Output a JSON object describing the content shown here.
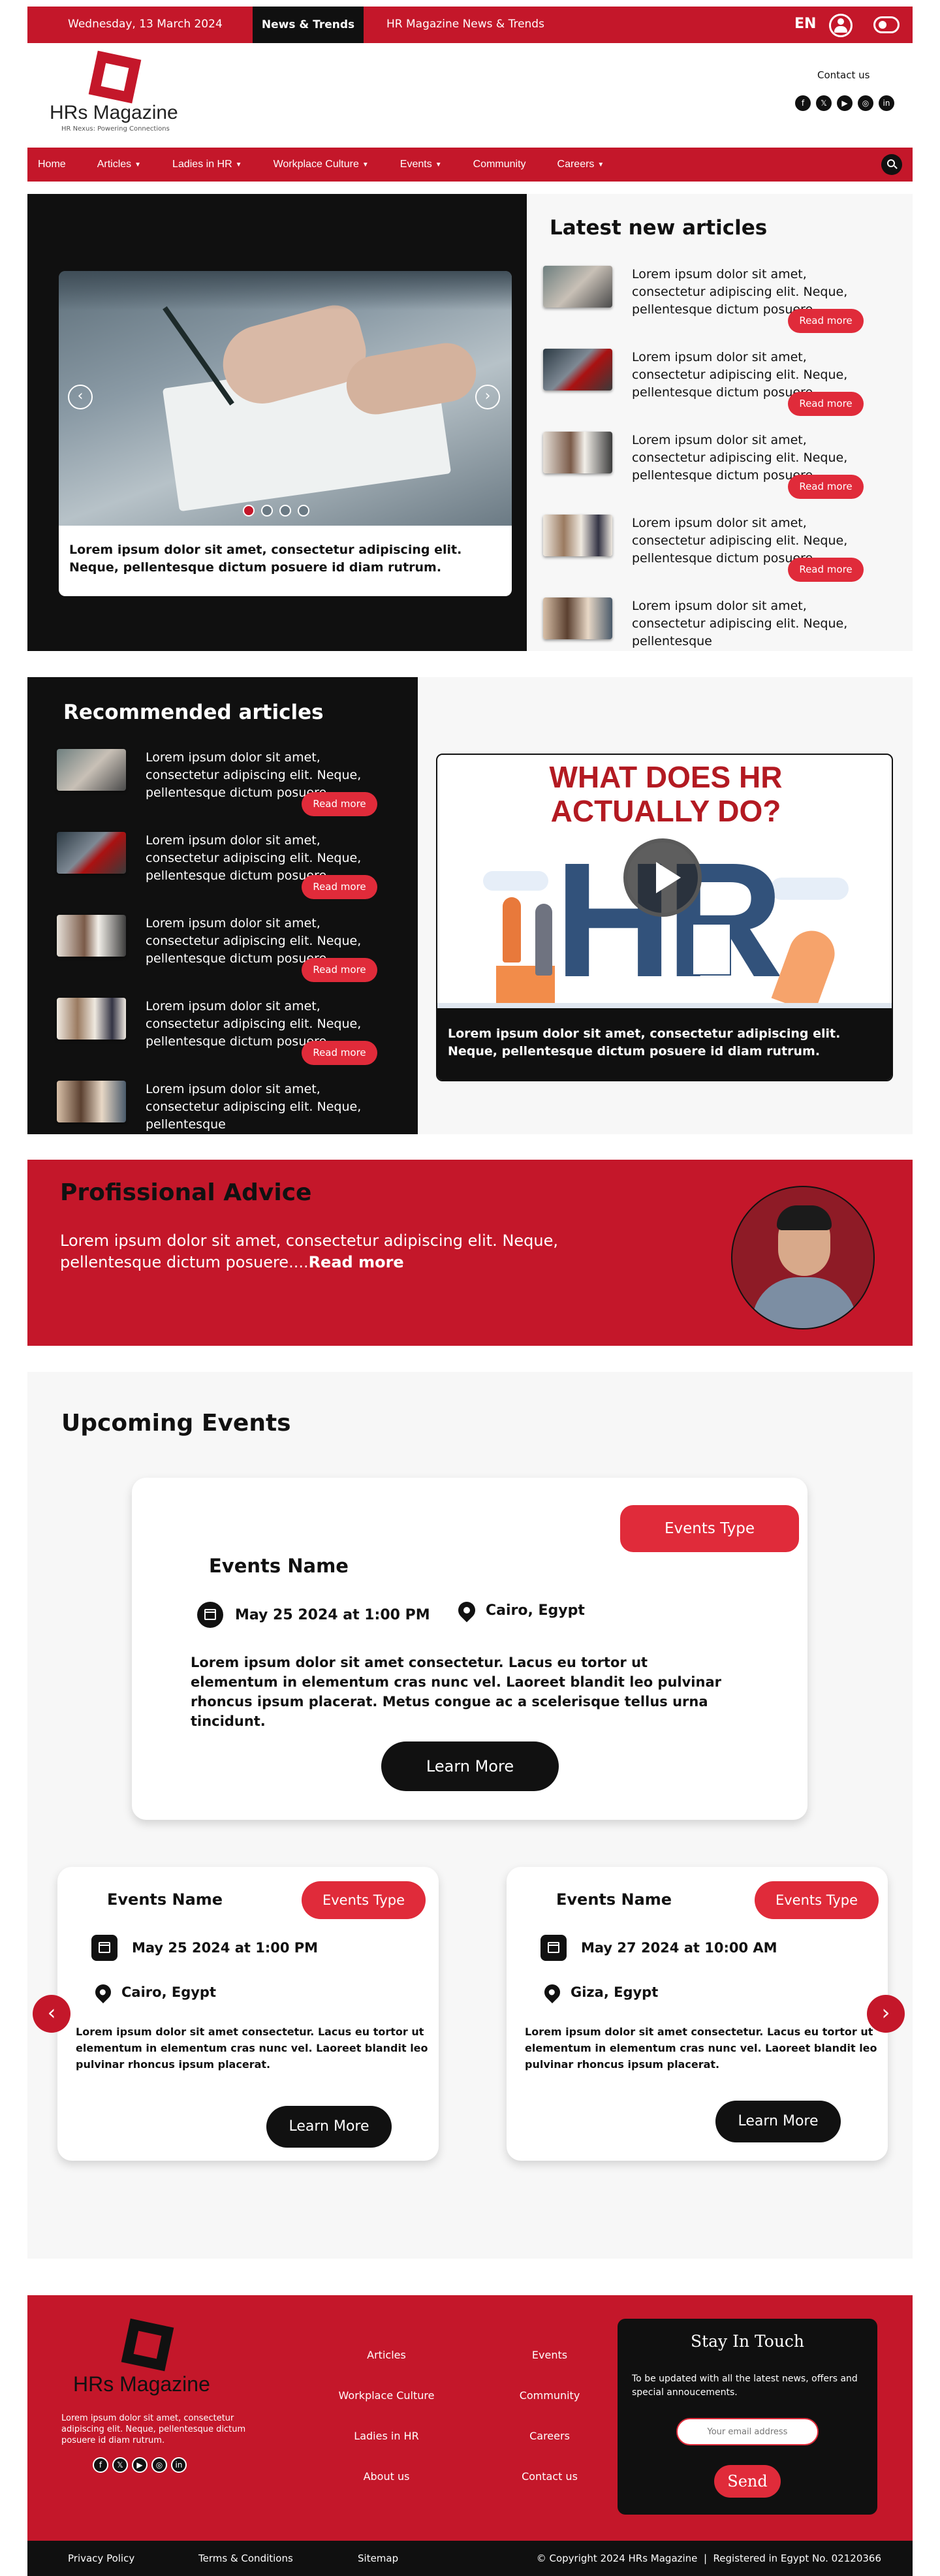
{
  "topbar": {
    "date": "Wednesday, 13 March 2024",
    "tab_active": "News & Trends",
    "tab_other": "HR Magazine News & Trends",
    "lang": "EN"
  },
  "brand": {
    "name": "HRs Magazine",
    "tagline": "HR Nexus: Powering Connections"
  },
  "header": {
    "contact": "Contact us"
  },
  "nav": {
    "items": [
      {
        "label": "Home",
        "caret": false
      },
      {
        "label": "Articles",
        "caret": true
      },
      {
        "label": "Ladies in HR",
        "caret": true
      },
      {
        "label": "Workplace Culture",
        "caret": true
      },
      {
        "label": "Events",
        "caret": true
      },
      {
        "label": "Community",
        "caret": false
      },
      {
        "label": "Careers",
        "caret": true
      }
    ]
  },
  "hero": {
    "caption": "Lorem ipsum dolor sit amet, consectetur adipiscing elit. Neque, pellentesque dictum posuere id diam rutrum.",
    "dots": 4
  },
  "latest": {
    "title": "Latest new articles",
    "items": [
      {
        "text": "Lorem ipsum dolor sit amet, consectetur adipiscing elit. Neque, pellentesque dictum posuere.....",
        "button": "Read more"
      },
      {
        "text": "Lorem ipsum dolor sit amet, consectetur adipiscing elit. Neque, pellentesque dictum posuere.....",
        "button": "Read more"
      },
      {
        "text": "Lorem ipsum dolor sit amet, consectetur adipiscing elit. Neque, pellentesque dictum posuere.....",
        "button": "Read more"
      },
      {
        "text": "Lorem ipsum dolor sit amet, consectetur adipiscing elit. Neque, pellentesque dictum posuere.....",
        "button": "Read more"
      },
      {
        "text": "Lorem ipsum dolor sit amet, consectetur adipiscing elit. Neque, pellentesque",
        "button": ""
      }
    ]
  },
  "recommended": {
    "title": "Recommended articles",
    "items": [
      {
        "text": "Lorem ipsum dolor sit amet, consectetur adipiscing elit. Neque, pellentesque dictum posuere.....",
        "button": "Read more"
      },
      {
        "text": "Lorem ipsum dolor sit amet, consectetur adipiscing elit. Neque, pellentesque dictum posuere.....",
        "button": "Read more"
      },
      {
        "text": "Lorem ipsum dolor sit amet, consectetur adipiscing elit. Neque, pellentesque dictum posuere.....",
        "button": "Read more"
      },
      {
        "text": "Lorem ipsum dolor sit amet, consectetur adipiscing elit. Neque, pellentesque dictum posuere.....",
        "button": "Read more"
      },
      {
        "text": "Lorem ipsum dolor sit amet, consectetur adipiscing elit. Neque, pellentesque",
        "button": ""
      }
    ]
  },
  "video": {
    "heading_line1": "WHAT DOES HR",
    "heading_line2": "ACTUALLY DO?",
    "art_letters": "HR",
    "caption": "Lorem ipsum dolor sit amet, consectetur adipiscing elit. Neque, pellentesque dictum posuere id diam rutrum."
  },
  "advice": {
    "title": "Profissional Advice",
    "text": "Lorem ipsum dolor sit amet, consectetur adipiscing elit. Neque, pellentesque dictum posuere....",
    "more": "Read more"
  },
  "events": {
    "title": "Upcoming Events",
    "featured": {
      "type": "Events Type",
      "name": "Events Name",
      "date": "May 25 2024 at 1:00 PM",
      "location": "Cairo, Egypt",
      "desc": "Lorem ipsum dolor sit amet consectetur. Lacus eu tortor ut elementum in elementum cras nunc vel. Laoreet blandit leo pulvinar rhoncus ipsum placerat. Metus congue ac a scelerisque tellus urna tincidunt.",
      "button": "Learn More"
    },
    "cards": [
      {
        "name": "Events Name",
        "type": "Events Type",
        "date": "May 25 2024 at 1:00 PM",
        "location": "Cairo, Egypt",
        "desc": "Lorem ipsum dolor sit amet consectetur. Lacus eu tortor ut elementum in elementum cras nunc vel. Laoreet blandit leo pulvinar rhoncus ipsum placerat.",
        "button": "Learn More"
      },
      {
        "name": "Events Name",
        "type": "Events Type",
        "date": "May 27 2024 at 10:00 AM",
        "location": "Giza, Egypt",
        "desc": "Lorem ipsum dolor sit amet consectetur. Lacus eu tortor ut elementum in elementum cras nunc vel. Laoreet blandit leo pulvinar rhoncus ipsum placerat.",
        "button": "Learn More"
      }
    ]
  },
  "footer": {
    "brand": "HRs Magazine",
    "about": "Lorem ipsum dolor sit amet, consectetur adipiscing elit. Neque, pellentesque dictum posuere id diam rutrum.",
    "links_col1": [
      "Articles",
      "Workplace Culture",
      "Ladies in HR",
      "About us"
    ],
    "links_col2": [
      "Events",
      "Community",
      "Careers",
      "Contact us"
    ],
    "stay_title": "Stay In Touch",
    "stay_text": "To be updated with all the latest news, offers and special annoucements.",
    "email_placeholder": "Your email address",
    "send": "Send",
    "bottom_links": [
      "Privacy Policy",
      "Terms & Conditions",
      "Sitemap"
    ],
    "copyright": "© Copyright 2024 HRs Magazine  |  Registered in Egypt No. 02120366"
  },
  "colors": {
    "brand_red": "#c4172a",
    "button_red": "#e02b3a",
    "dark": "#101010"
  },
  "icons": [
    "user-icon",
    "toggle-icon",
    "facebook-icon",
    "x-icon",
    "youtube-icon",
    "instagram-icon",
    "linkedin-icon",
    "search-icon",
    "chevron-left-icon",
    "chevron-right-icon",
    "play-icon",
    "calendar-icon",
    "location-pin-icon"
  ]
}
